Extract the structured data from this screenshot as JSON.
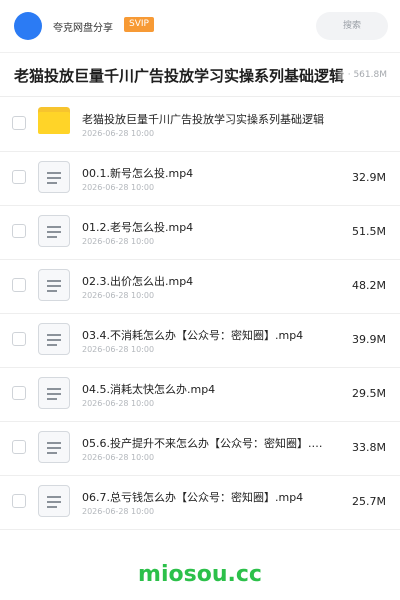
{
  "header": {
    "share_name": "夸克网盘分享",
    "badge": "SVIP",
    "search_placeholder": "搜索"
  },
  "folder": {
    "title": "老猫投放巨量千川广告投放学习实操系列基础逻辑",
    "meta": "· 561.8M"
  },
  "files": [
    {
      "name": "老猫投放巨量千川广告投放学习实操系列基础逻辑",
      "date": "2026-06-28 10:00",
      "size": "",
      "type": "folder"
    },
    {
      "name": "00.1.新号怎么投.mp4",
      "date": "2026-06-28 10:00",
      "size": "32.9M",
      "type": "video"
    },
    {
      "name": "01.2.老号怎么投.mp4",
      "date": "2026-06-28 10:00",
      "size": "51.5M",
      "type": "video"
    },
    {
      "name": "02.3.出价怎么出.mp4",
      "date": "2026-06-28 10:00",
      "size": "48.2M",
      "type": "video"
    },
    {
      "name": "03.4.不消耗怎么办【公众号：密知圈】.mp4",
      "date": "2026-06-28 10:00",
      "size": "39.9M",
      "type": "video"
    },
    {
      "name": "04.5.消耗太快怎么办.mp4",
      "date": "2026-06-28 10:00",
      "size": "29.5M",
      "type": "video"
    },
    {
      "name": "05.6.投产提升不来怎么办【公众号：密知圈】.m…",
      "date": "2026-06-28 10:00",
      "size": "33.8M",
      "type": "video"
    },
    {
      "name": "06.7.总亏钱怎么办【公众号：密知圈】.mp4",
      "date": "2026-06-28 10:00",
      "size": "25.7M",
      "type": "video"
    }
  ],
  "watermark": "miosou.cc",
  "colors": {
    "avatar": "#2b7bf4",
    "badge": "#f79a35",
    "folder": "#ffd428",
    "watermark": "#2cc04a"
  },
  "icons": {
    "folder": "folder-icon",
    "video": "document-icon",
    "search": "search-field"
  }
}
